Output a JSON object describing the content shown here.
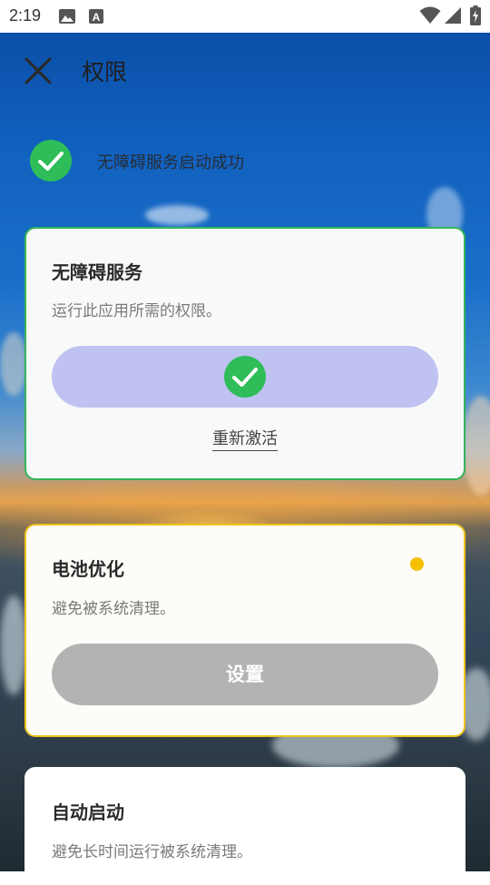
{
  "status_bar": {
    "time": "2:19",
    "icons": [
      "image-icon",
      "text-a-icon",
      "wifi-icon",
      "signal-icon",
      "battery-charging-icon"
    ]
  },
  "header": {
    "title": "权限",
    "close_icon": "close-icon"
  },
  "banner": {
    "icon": "check-circle-icon",
    "text": "无障碍服务启动成功"
  },
  "cards": {
    "accessibility": {
      "title": "无障碍服务",
      "description": "运行此应用所需的权限。",
      "button_icon": "check-circle-icon",
      "reactivate_label": "重新激活",
      "border_color": "#35b45a"
    },
    "battery": {
      "title": "电池优化",
      "description": "避免被系统清理。",
      "button_label": "设置",
      "status_color": "#f5c000",
      "border_color": "#f0c31f"
    },
    "autostart": {
      "title": "自动启动",
      "description": "避免长时间运行被系统清理。"
    }
  },
  "colors": {
    "success_green": "#2ebd58",
    "done_button": "#c0c2f2",
    "disabled_button": "#b3b3b3"
  }
}
